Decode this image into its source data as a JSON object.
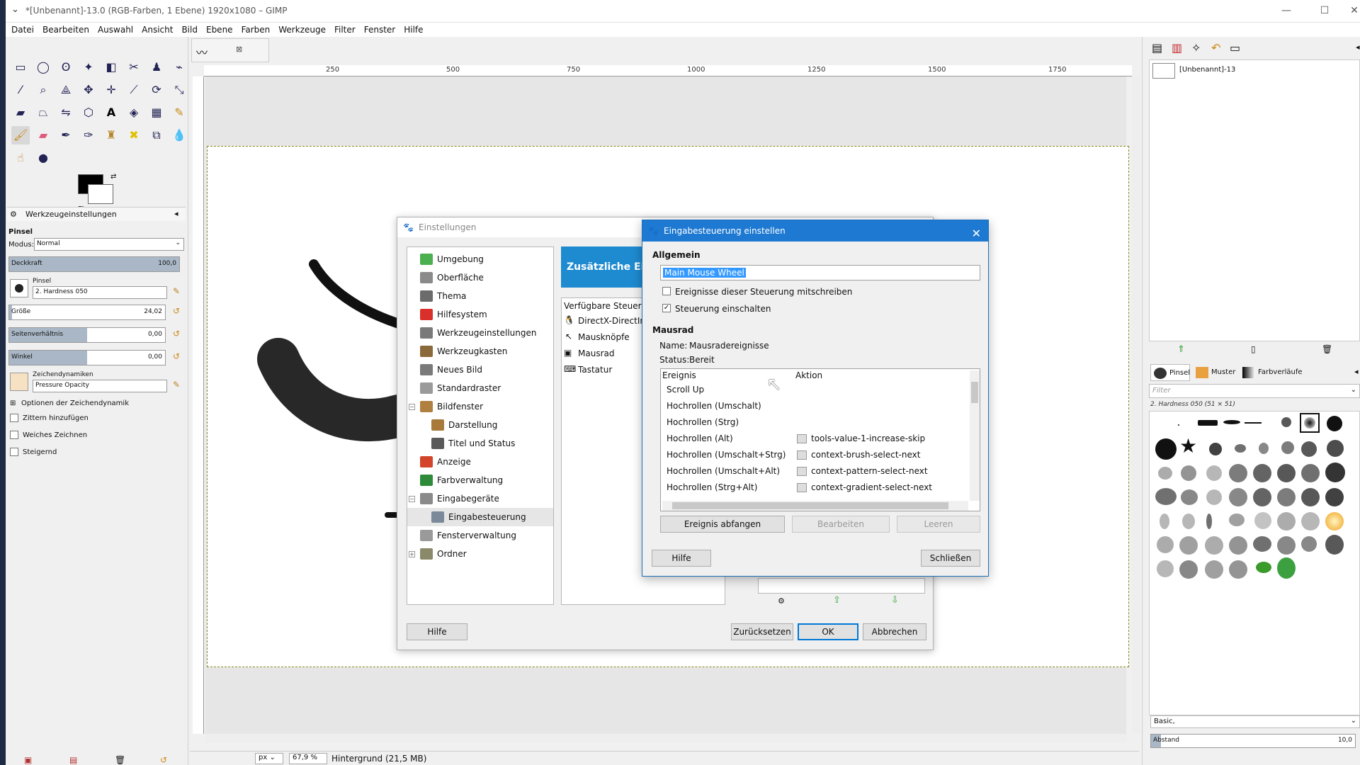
{
  "window": {
    "title": "*[Unbenannt]-13.0 (RGB-Farben, 1 Ebene) 1920x1080 – GIMP",
    "menu": [
      "Datei",
      "Bearbeiten",
      "Auswahl",
      "Ansicht",
      "Bild",
      "Ebene",
      "Farben",
      "Werkzeuge",
      "Filter",
      "Fenster",
      "Hilfe"
    ]
  },
  "tool_options": {
    "tab_title": "Werkzeugeinstellungen",
    "tool_name": "Pinsel",
    "mode_label": "Modus:",
    "mode_value": "Normal",
    "opacity_label": "Deckkraft",
    "opacity_value": "100,0",
    "brush_label": "Pinsel",
    "brush_value": "2. Hardness 050",
    "size_label": "Größe",
    "size_value": "24,02",
    "aspect_label": "Seitenverhältnis",
    "aspect_value": "0,00",
    "angle_label": "Winkel",
    "angle_value": "0,00",
    "dynamics_label": "Zeichendynamiken",
    "dynamics_value": "Pressure Opacity",
    "dynamics_options": "Optionen der Zeichendynamik",
    "jitter": "Zittern hinzufügen",
    "smooth": "Weiches Zeichnen",
    "incremental": "Steigernd"
  },
  "canvas": {
    "ruler_labels": [
      "250",
      "500",
      "750",
      "1000",
      "1250",
      "1500",
      "1750"
    ],
    "unit": "px",
    "zoom": "67,9 %",
    "status": "Hintergrund (21,5 MB)"
  },
  "right_dock": {
    "image_name": "[Unbenannt]-13",
    "tabs": [
      "Pinsel",
      "Muster",
      "Farbverläufe"
    ],
    "filter_placeholder": "Filter",
    "brush_info": "2. Hardness 050 (51 × 51)",
    "preset": "Basic,",
    "spacing_label": "Abstand",
    "spacing_value": "10,0"
  },
  "preferences": {
    "title": "Einstellungen",
    "header": "Zusätzliche Eingabe",
    "tree": [
      {
        "label": "Umgebung",
        "level": 0,
        "color": "#4caf50"
      },
      {
        "label": "Oberfläche",
        "level": 0,
        "color": "#8a8a8a"
      },
      {
        "label": "Thema",
        "level": 0,
        "color": "#6b6b6b"
      },
      {
        "label": "Hilfesystem",
        "level": 0,
        "color": "#d9302c"
      },
      {
        "label": "Werkzeugeinstellungen",
        "level": 0,
        "color": "#7a7a7a"
      },
      {
        "label": "Werkzeugkasten",
        "level": 0,
        "color": "#8a6a3a"
      },
      {
        "label": "Neues Bild",
        "level": 0,
        "color": "#7a7a7a"
      },
      {
        "label": "Standardraster",
        "level": 0,
        "color": "#9a9a9a"
      },
      {
        "label": "Bildfenster",
        "level": 0,
        "color": "#b08040",
        "expand": "−"
      },
      {
        "label": "Darstellung",
        "level": 1,
        "color": "#a87a3a"
      },
      {
        "label": "Titel und Status",
        "level": 1,
        "color": "#5a5a5a"
      },
      {
        "label": "Anzeige",
        "level": 0,
        "color": "#d2452a"
      },
      {
        "label": "Farbverwaltung",
        "level": 0,
        "color": "#2e8b3a"
      },
      {
        "label": "Eingabegeräte",
        "level": 0,
        "color": "#8a8a8a",
        "expand": "−"
      },
      {
        "label": "Eingabesteuerung",
        "level": 1,
        "color": "#7a8a9a",
        "selected": true
      },
      {
        "label": "Fensterverwaltung",
        "level": 0,
        "color": "#9a9a9a"
      },
      {
        "label": "Ordner",
        "level": 0,
        "color": "#8a8a6a",
        "expand": "+"
      }
    ],
    "available_label": "Verfügbare Steuerungen",
    "available": [
      "DirectX-DirectInput",
      "Mausknöpfe",
      "Mausrad",
      "Tastatur"
    ],
    "buttons": {
      "help": "Hilfe",
      "reset": "Zurücksetzen",
      "ok": "OK",
      "cancel": "Abbrechen"
    }
  },
  "controller_dialog": {
    "title": "Eingabesteuerung einstellen",
    "section_general": "Allgemein",
    "name_value": "Main Mouse Wheel",
    "log_events": "Ereignisse dieser Steuerung mitschreiben",
    "enable": "Steuerung einschalten",
    "section_wheel": "Mausrad",
    "name_label": "Name:",
    "name_info": "Mausradereignisse",
    "status_label": "Status:",
    "status_value": "Bereit",
    "col_event": "Ereignis",
    "col_action": "Aktion",
    "rows": [
      {
        "event": "Scroll Up",
        "action": ""
      },
      {
        "event": "Hochrollen (Umschalt)",
        "action": ""
      },
      {
        "event": "Hochrollen (Strg)",
        "action": ""
      },
      {
        "event": "Hochrollen (Alt)",
        "action": "tools-value-1-increase-skip"
      },
      {
        "event": "Hochrollen (Umschalt+Strg)",
        "action": "context-brush-select-next"
      },
      {
        "event": "Hochrollen (Umschalt+Alt)",
        "action": "context-pattern-select-next"
      },
      {
        "event": "Hochrollen (Strg+Alt)",
        "action": "context-gradient-select-next"
      }
    ],
    "buttons": {
      "grab": "Ereignis abfangen",
      "edit": "Bearbeiten",
      "clear": "Leeren",
      "help": "Hilfe",
      "close": "Schließen"
    }
  }
}
